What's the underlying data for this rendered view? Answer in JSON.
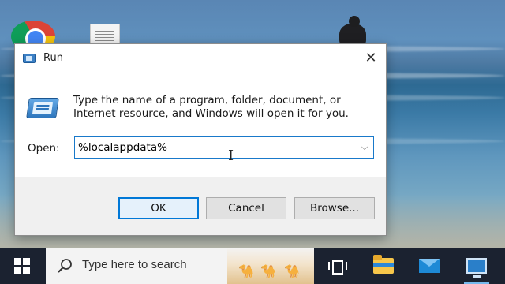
{
  "dialog": {
    "title": "Run",
    "description": "Type the name of a program, folder, document, or Internet resource, and Windows will open it for you.",
    "open_label": "Open:",
    "open_value": "%localappdata%",
    "buttons": {
      "ok": "OK",
      "cancel": "Cancel",
      "browse": "Browse..."
    }
  },
  "taskbar": {
    "search_placeholder": "Type here to search",
    "pinned": [
      "task-view-icon",
      "file-explorer-icon",
      "mail-icon",
      "remote-desktop-icon"
    ]
  },
  "desktop": {
    "icons": [
      "chrome-icon",
      "document-icon"
    ]
  },
  "colors": {
    "accent": "#0078d7",
    "taskbar": "#1b2230",
    "dialog_footer": "#f0f0f0"
  }
}
